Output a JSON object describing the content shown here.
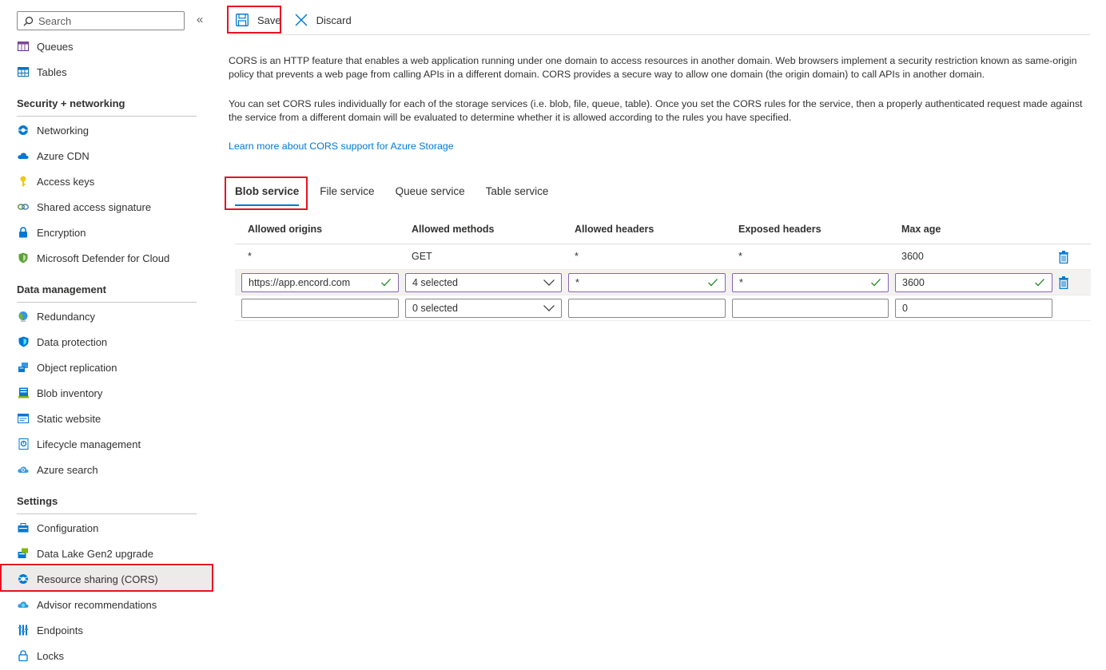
{
  "sidebar": {
    "search_placeholder": "Search",
    "collapse_glyph": "«",
    "top_items": [
      {
        "label": "Queues",
        "icon": "queue-icon"
      },
      {
        "label": "Tables",
        "icon": "table-icon"
      }
    ],
    "sections": [
      {
        "title": "Security + networking",
        "items": [
          {
            "label": "Networking",
            "icon": "networking-icon"
          },
          {
            "label": "Azure CDN",
            "icon": "cdn-icon"
          },
          {
            "label": "Access keys",
            "icon": "key-icon"
          },
          {
            "label": "Shared access signature",
            "icon": "link-icon"
          },
          {
            "label": "Encryption",
            "icon": "lock-icon"
          },
          {
            "label": "Microsoft Defender for Cloud",
            "icon": "shield-icon"
          }
        ]
      },
      {
        "title": "Data management",
        "items": [
          {
            "label": "Redundancy",
            "icon": "globe-icon"
          },
          {
            "label": "Data protection",
            "icon": "protection-icon"
          },
          {
            "label": "Object replication",
            "icon": "replication-icon"
          },
          {
            "label": "Blob inventory",
            "icon": "inventory-icon"
          },
          {
            "label": "Static website",
            "icon": "website-icon"
          },
          {
            "label": "Lifecycle management",
            "icon": "lifecycle-icon"
          },
          {
            "label": "Azure search",
            "icon": "search-cloud-icon"
          }
        ]
      },
      {
        "title": "Settings",
        "items": [
          {
            "label": "Configuration",
            "icon": "configuration-icon"
          },
          {
            "label": "Data Lake Gen2 upgrade",
            "icon": "datalake-icon"
          },
          {
            "label": "Resource sharing (CORS)",
            "icon": "cors-icon",
            "selected": true
          },
          {
            "label": "Advisor recommendations",
            "icon": "advisor-icon"
          },
          {
            "label": "Endpoints",
            "icon": "endpoints-icon"
          },
          {
            "label": "Locks",
            "icon": "padlock-icon"
          }
        ]
      }
    ]
  },
  "toolbar": {
    "save_label": "Save",
    "discard_label": "Discard"
  },
  "description": {
    "para1": "CORS is an HTTP feature that enables a web application running under one domain to access resources in another domain. Web browsers implement a security restriction known as same-origin policy that prevents a web page from calling APIs in a different domain. CORS provides a secure way to allow one domain (the origin domain) to call APIs in another domain.",
    "para2": "You can set CORS rules individually for each of the storage services (i.e. blob, file, queue, table). Once you set the CORS rules for the service, then a properly authenticated request made against the service from a different domain will be evaluated to determine whether it is allowed according to the rules you have specified.",
    "learn_more": "Learn more about CORS support for Azure Storage"
  },
  "tabs": [
    {
      "label": "Blob service",
      "active": true
    },
    {
      "label": "File service"
    },
    {
      "label": "Queue service"
    },
    {
      "label": "Table service"
    }
  ],
  "grid": {
    "headers": {
      "origins": "Allowed origins",
      "methods": "Allowed methods",
      "allowed_headers": "Allowed headers",
      "exposed_headers": "Exposed headers",
      "max_age": "Max age"
    },
    "saved_row": {
      "origins": "*",
      "methods": "GET",
      "allowed_headers": "*",
      "exposed_headers": "*",
      "max_age": "3600"
    },
    "edit_row": {
      "origins": "https://app.encord.com",
      "methods": "4 selected",
      "allowed_headers": "*",
      "exposed_headers": "*",
      "max_age": "3600"
    },
    "new_row": {
      "origins": "",
      "methods": "0 selected",
      "allowed_headers": "",
      "exposed_headers": "",
      "max_age": "0"
    }
  },
  "colors": {
    "accent": "#0078d4",
    "highlight_box": "#e81123",
    "valid_check": "#107c10"
  }
}
